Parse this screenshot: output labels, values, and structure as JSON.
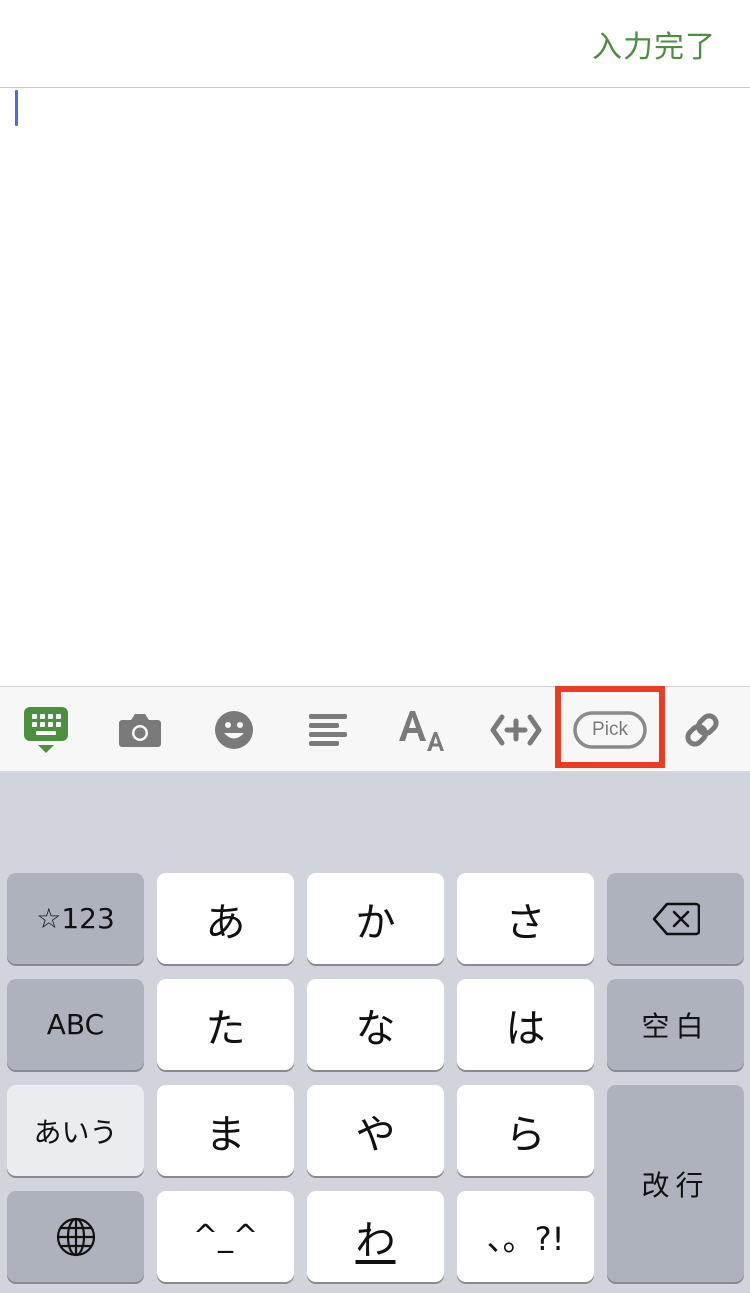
{
  "header": {
    "done_label": "入力完了"
  },
  "toolbar": {
    "items": [
      {
        "name": "keyboard-icon"
      },
      {
        "name": "camera-icon"
      },
      {
        "name": "emoji-icon"
      },
      {
        "name": "align-icon"
      },
      {
        "name": "font-size-icon"
      },
      {
        "name": "insert-embed-icon"
      },
      {
        "name": "pick-icon",
        "label": "Pick"
      },
      {
        "name": "link-icon"
      }
    ],
    "accent_color": "#4b8f3f",
    "highlight_color": "#ee3b24"
  },
  "keyboard": {
    "num_key": "☆123",
    "abc_key": "ABC",
    "aiu_key": "あいう",
    "rows": [
      [
        "あ",
        "か",
        "さ"
      ],
      [
        "た",
        "な",
        "は"
      ],
      [
        "ま",
        "や",
        "ら"
      ],
      [
        "^_^",
        "わ",
        "、。?!"
      ]
    ],
    "space_key": "空白",
    "enter_key": "改行"
  }
}
